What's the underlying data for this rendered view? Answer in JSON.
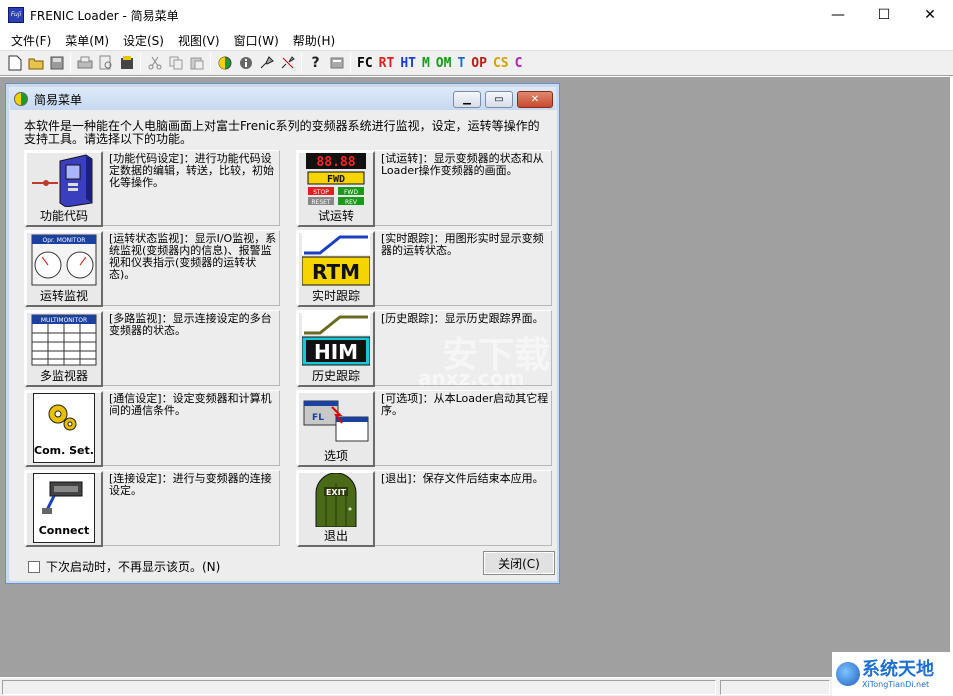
{
  "window": {
    "title": "FRENIC Loader - 简易菜单",
    "app_icon_text": "Fuji",
    "minimize": "—",
    "maximize": "☐",
    "close": "✕"
  },
  "menubar": [
    "文件(F)",
    "菜单(M)",
    "设定(S)",
    "视图(V)",
    "窗口(W)",
    "帮助(H)"
  ],
  "toolbar": {
    "text_buttons": [
      {
        "label": "FC",
        "color": "#000000"
      },
      {
        "label": "RT",
        "color": "#e02020"
      },
      {
        "label": "HT",
        "color": "#1a3fd0"
      },
      {
        "label": "M",
        "color": "#1a9a1a"
      },
      {
        "label": "OM",
        "color": "#1a9a1a"
      },
      {
        "label": "T",
        "color": "#1a6ad0"
      },
      {
        "label": "OP",
        "color": "#c01818"
      },
      {
        "label": "CS",
        "color": "#d8a000"
      },
      {
        "label": "C",
        "color": "#b020b0"
      }
    ]
  },
  "dialog": {
    "title": "简易菜单",
    "intro": "本软件是一种能在个人电脑画面上对富士Frenic系列的变频器系统进行监视，设定，运转等操作的支持工具。请选择以下的功能。",
    "items": [
      {
        "label": "功能代码",
        "desc": "[功能代码设定]：进行功能代码设定数据的编辑，转送，比较，初始化等操作。"
      },
      {
        "label": "试运转",
        "desc": "[试运转]：显示变频器的状态和从Loader操作变频器的画面。",
        "art": {
          "digits": "88.88",
          "fwd": "FWD",
          "stop": "STOP",
          "fwd2": "FWD",
          "reset": "RESET",
          "rev": "REV"
        }
      },
      {
        "label": "运转监视",
        "desc": "[运转状态监视]：显示I/O监视，系统监视(变频器内的信息)、报警监视和仪表指示(变频器的运转状态)。",
        "art": {
          "header": "Opr. MONITOR"
        }
      },
      {
        "label": "实时跟踪",
        "desc": "[实时跟踪]：用图形实时显示变频器的运转状态。",
        "art": {
          "text": "RTM"
        }
      },
      {
        "label": "多监视器",
        "desc": "[多路监视]：显示连接设定的多台变频器的状态。",
        "art": {
          "header": "MULTIMONITOR"
        }
      },
      {
        "label": "历史跟踪",
        "desc": "[历史跟踪]：显示历史跟踪界面。",
        "art": {
          "text": "HIM"
        }
      },
      {
        "label": "Com. Set.",
        "desc": "[通信设定]：设定变频器和计算机间的通信条件。"
      },
      {
        "label": "选项",
        "desc": "[可选项]：从本Loader启动其它程序。",
        "art": {
          "text": "FL"
        }
      },
      {
        "label": "Connect",
        "desc": "[连接设定]：进行与变频器的连接设定。"
      },
      {
        "label": "退出",
        "desc": "[退出]：保存文件后结束本应用。",
        "art": {
          "text": "EXIT"
        }
      }
    ],
    "checkbox_label": "下次启动时，不再显示该页。(N)",
    "close_button": "关闭(C)"
  },
  "watermark": {
    "main": "安下载",
    "sub": "anxz.com"
  },
  "brand": {
    "main": "系统天地",
    "sub": "XiTongTianDi.net"
  }
}
